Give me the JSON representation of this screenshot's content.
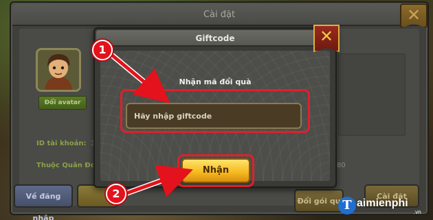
{
  "outer_window": {
    "title": "Cài đặt",
    "close_glyph": "✕",
    "avatar_button": "Đổi avatar",
    "account_id_label": "ID tài khoản:",
    "account_id_value": "3",
    "guild_label": "Thuộc Quân Đoàn:",
    "guild_value_tail": "80",
    "buttons": {
      "logout": "Về đăng nhập",
      "change_pack": "Đổi gói qu",
      "settings": "Cài đặt"
    }
  },
  "giftcode_dialog": {
    "title": "Giftcode",
    "close_glyph": "✕",
    "label": "Nhận mã đổi quà",
    "input_placeholder": "Hãy nhập giftcode",
    "input_value": "",
    "redeem_button": "Nhận"
  },
  "annotations": {
    "step_1": "1",
    "step_2": "2",
    "highlight_color": "#e0202a"
  },
  "watermark": {
    "logo_letter": "T",
    "brand": "aimienphi",
    "suffix": ".vn"
  },
  "icons": [
    "close-icon",
    "avatar-portrait",
    "arrow-icon"
  ]
}
